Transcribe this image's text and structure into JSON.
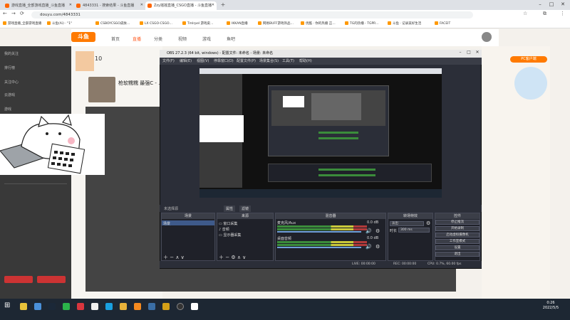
{
  "browser": {
    "tabs": [
      {
        "label": "游戏直播_全部游戏直播_斗鱼直播"
      },
      {
        "label": "4843331 - 搜索结果 - 斗鱼直播"
      },
      {
        "label": "Zzy摇摇直播_CSGO直播 - 斗鱼直播",
        "active": true
      }
    ],
    "new_tab": "+",
    "address": "douyu.com/4843331",
    "bookmarks": [
      "游戏直播_全部游戏直播",
      "斗鱼(Ai) · \"1\"",
      "CSBOYCSGO皮肤…",
      "LX CSGO·CSGO…",
      "Tmlrpel 游戏皮…",
      "IKKAN直播",
      "网易BUFF游戏饰品…",
      "优酷 · 你的热播 正…",
      "TG的热播 - TGPR…",
      "斗鱼 · 记录美好生活",
      "FACEIT"
    ]
  },
  "douyu": {
    "logo": "斗鱼",
    "nav": [
      "首页",
      "直播",
      "分类",
      "视频",
      "游戏",
      "鱼吧"
    ],
    "sidebar": [
      "我的关注",
      "排行榜",
      "关注中心",
      "云游戏",
      "游戏"
    ],
    "streamer_title": "枪软糯糯 最强C - ...",
    "followers": "10",
    "right_label": "PC客户端"
  },
  "obs": {
    "title": "OBS 27.2.3 (64 bit, windows) - 配置文件: 未命名 - 场景: 未命名",
    "menu": [
      "文件(F)",
      "编辑(E)",
      "视图(V)",
      "停靠窗口(D)",
      "配置文件(P)",
      "场景集合(S)",
      "工具(T)",
      "帮助(H)"
    ],
    "no_source": "未选择源",
    "props_btn": "属性",
    "filter_btn": "滤镜",
    "panels": {
      "scenes": "场景",
      "sources": "来源",
      "mixer": "混音器",
      "transitions": "转场特效",
      "controls": "控件"
    },
    "scene_item": "场景",
    "sources": [
      "窗口采集",
      "音频",
      "显示器采集"
    ],
    "mixer_tracks": [
      {
        "name": "麦克风/Aux",
        "db": "0.0 dB"
      },
      {
        "name": "桌面音频",
        "db": "0.0 dB"
      }
    ],
    "transition": "淡出",
    "duration_label": "时长",
    "duration": "300 ms",
    "controls": [
      "停止推流",
      "开始录制",
      "启动虚拟摄像机",
      "工作室模式",
      "设置",
      "退出"
    ],
    "status": {
      "live": "LIVE: 00:00:00",
      "rec": "REC: 00:00:00",
      "cpu": "CPU: 0.7%, 60.00 fps"
    }
  },
  "taskbar": {
    "time": "0:26",
    "date": "2022/5/5"
  }
}
